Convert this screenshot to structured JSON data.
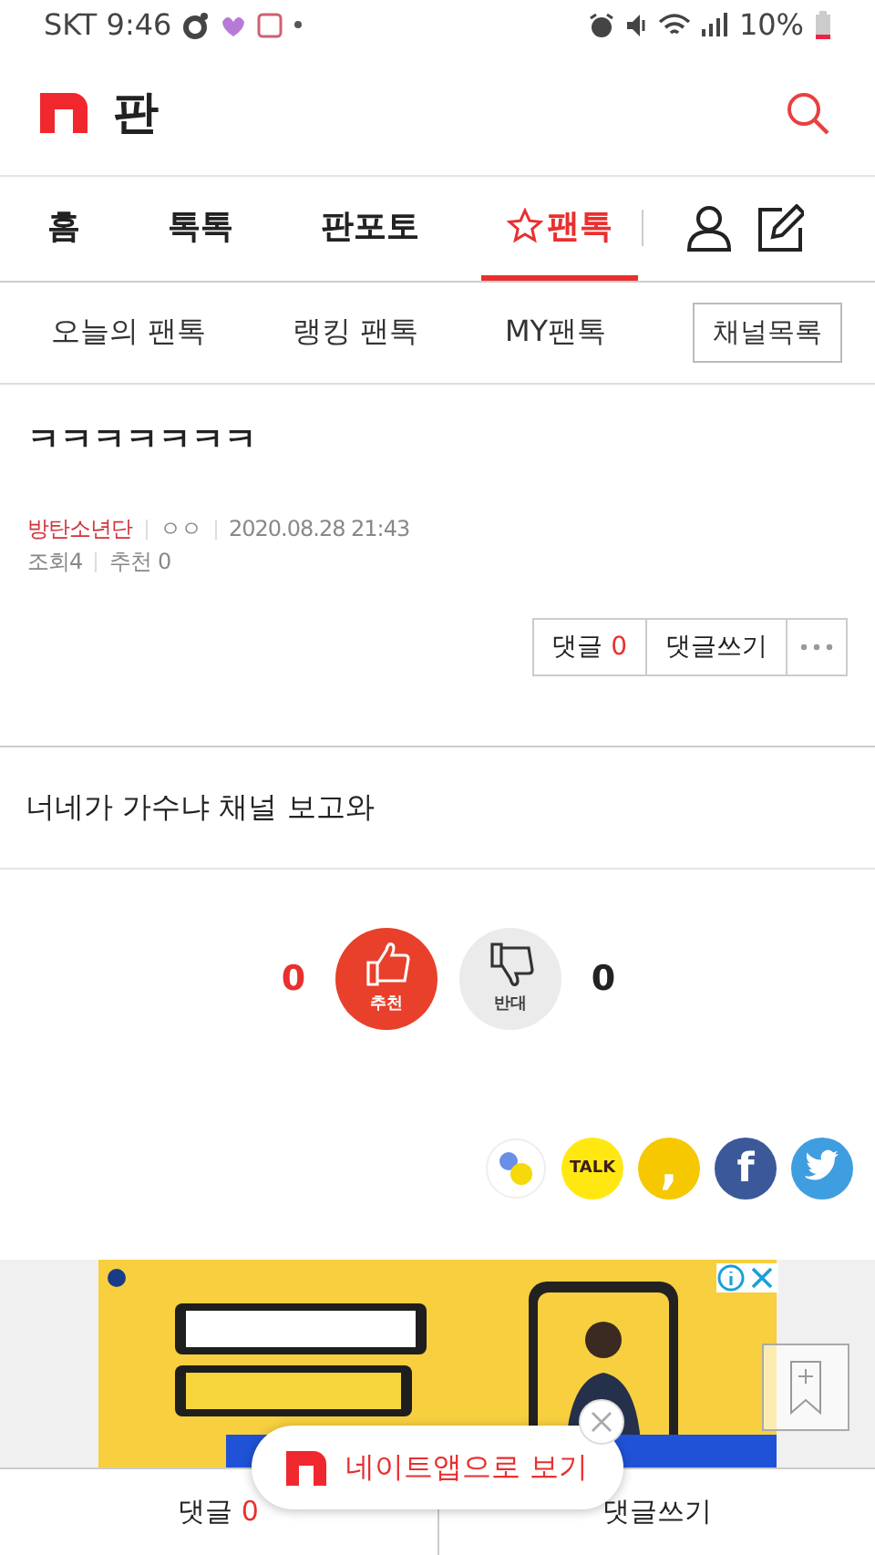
{
  "status_bar": {
    "time": "SKT 9:46",
    "battery": "10%"
  },
  "header": {
    "title": "판"
  },
  "nav": {
    "tabs": [
      {
        "label": "홈",
        "star": false,
        "selected": false
      },
      {
        "label": "톡톡",
        "star": false,
        "selected": false
      },
      {
        "label": "판포토",
        "star": false,
        "selected": false
      },
      {
        "label": "팬톡",
        "star": true,
        "selected": true
      }
    ]
  },
  "subnav": {
    "items": [
      "오늘의 팬톡",
      "랭킹 팬톡",
      "MY팬톡"
    ],
    "channel_button": "채널목록"
  },
  "post": {
    "title": "ㅋㅋㅋㅋㅋㅋㅋ",
    "channel": "방탄소년단",
    "author": "ㅇㅇ",
    "date": "2020.08.28 21:43",
    "views": "조회4",
    "likes": "추천 0",
    "comment_label": "댓글",
    "comment_count": "0",
    "write_label": "댓글쓰기",
    "body": "너네가 가수냐 채널 보고와"
  },
  "votes": {
    "up_count": "0",
    "up_label": "추천",
    "down_label": "반대",
    "down_count": "0"
  },
  "share": [
    {
      "kind": "story"
    },
    {
      "kind": "talk",
      "label": "TALK"
    },
    {
      "kind": "comma",
      "label": ","
    },
    {
      "kind": "facebook",
      "label": "f"
    },
    {
      "kind": "twitter"
    }
  ],
  "app_banner": {
    "text": "네이트앱으로 보기"
  },
  "bottom_bar": {
    "comment_label": "댓글",
    "comment_count": "0",
    "write_label": "댓글쓰기"
  }
}
